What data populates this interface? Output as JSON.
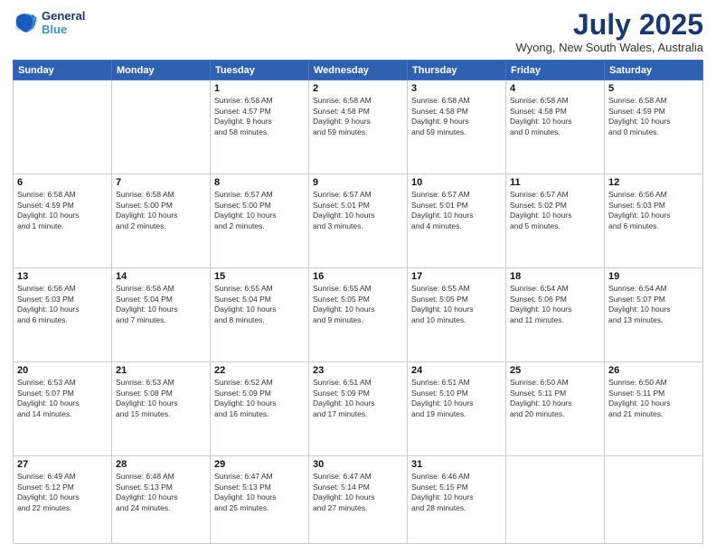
{
  "header": {
    "logo_line1": "General",
    "logo_line2": "Blue",
    "month": "July 2025",
    "location": "Wyong, New South Wales, Australia"
  },
  "days_of_week": [
    "Sunday",
    "Monday",
    "Tuesday",
    "Wednesday",
    "Thursday",
    "Friday",
    "Saturday"
  ],
  "weeks": [
    [
      {
        "day": "",
        "info": ""
      },
      {
        "day": "",
        "info": ""
      },
      {
        "day": "1",
        "info": "Sunrise: 6:58 AM\nSunset: 4:57 PM\nDaylight: 9 hours\nand 58 minutes."
      },
      {
        "day": "2",
        "info": "Sunrise: 6:58 AM\nSunset: 4:58 PM\nDaylight: 9 hours\nand 59 minutes."
      },
      {
        "day": "3",
        "info": "Sunrise: 6:58 AM\nSunset: 4:58 PM\nDaylight: 9 hours\nand 59 minutes."
      },
      {
        "day": "4",
        "info": "Sunrise: 6:58 AM\nSunset: 4:58 PM\nDaylight: 10 hours\nand 0 minutes."
      },
      {
        "day": "5",
        "info": "Sunrise: 6:58 AM\nSunset: 4:59 PM\nDaylight: 10 hours\nand 0 minutes."
      }
    ],
    [
      {
        "day": "6",
        "info": "Sunrise: 6:58 AM\nSunset: 4:59 PM\nDaylight: 10 hours\nand 1 minute."
      },
      {
        "day": "7",
        "info": "Sunrise: 6:58 AM\nSunset: 5:00 PM\nDaylight: 10 hours\nand 2 minutes."
      },
      {
        "day": "8",
        "info": "Sunrise: 6:57 AM\nSunset: 5:00 PM\nDaylight: 10 hours\nand 2 minutes."
      },
      {
        "day": "9",
        "info": "Sunrise: 6:57 AM\nSunset: 5:01 PM\nDaylight: 10 hours\nand 3 minutes."
      },
      {
        "day": "10",
        "info": "Sunrise: 6:57 AM\nSunset: 5:01 PM\nDaylight: 10 hours\nand 4 minutes."
      },
      {
        "day": "11",
        "info": "Sunrise: 6:57 AM\nSunset: 5:02 PM\nDaylight: 10 hours\nand 5 minutes."
      },
      {
        "day": "12",
        "info": "Sunrise: 6:56 AM\nSunset: 5:03 PM\nDaylight: 10 hours\nand 6 minutes."
      }
    ],
    [
      {
        "day": "13",
        "info": "Sunrise: 6:56 AM\nSunset: 5:03 PM\nDaylight: 10 hours\nand 6 minutes."
      },
      {
        "day": "14",
        "info": "Sunrise: 6:56 AM\nSunset: 5:04 PM\nDaylight: 10 hours\nand 7 minutes."
      },
      {
        "day": "15",
        "info": "Sunrise: 6:55 AM\nSunset: 5:04 PM\nDaylight: 10 hours\nand 8 minutes."
      },
      {
        "day": "16",
        "info": "Sunrise: 6:55 AM\nSunset: 5:05 PM\nDaylight: 10 hours\nand 9 minutes."
      },
      {
        "day": "17",
        "info": "Sunrise: 6:55 AM\nSunset: 5:05 PM\nDaylight: 10 hours\nand 10 minutes."
      },
      {
        "day": "18",
        "info": "Sunrise: 6:54 AM\nSunset: 5:06 PM\nDaylight: 10 hours\nand 11 minutes."
      },
      {
        "day": "19",
        "info": "Sunrise: 6:54 AM\nSunset: 5:07 PM\nDaylight: 10 hours\nand 13 minutes."
      }
    ],
    [
      {
        "day": "20",
        "info": "Sunrise: 6:53 AM\nSunset: 5:07 PM\nDaylight: 10 hours\nand 14 minutes."
      },
      {
        "day": "21",
        "info": "Sunrise: 6:53 AM\nSunset: 5:08 PM\nDaylight: 10 hours\nand 15 minutes."
      },
      {
        "day": "22",
        "info": "Sunrise: 6:52 AM\nSunset: 5:09 PM\nDaylight: 10 hours\nand 16 minutes."
      },
      {
        "day": "23",
        "info": "Sunrise: 6:51 AM\nSunset: 5:09 PM\nDaylight: 10 hours\nand 17 minutes."
      },
      {
        "day": "24",
        "info": "Sunrise: 6:51 AM\nSunset: 5:10 PM\nDaylight: 10 hours\nand 19 minutes."
      },
      {
        "day": "25",
        "info": "Sunrise: 6:50 AM\nSunset: 5:11 PM\nDaylight: 10 hours\nand 20 minutes."
      },
      {
        "day": "26",
        "info": "Sunrise: 6:50 AM\nSunset: 5:11 PM\nDaylight: 10 hours\nand 21 minutes."
      }
    ],
    [
      {
        "day": "27",
        "info": "Sunrise: 6:49 AM\nSunset: 5:12 PM\nDaylight: 10 hours\nand 22 minutes."
      },
      {
        "day": "28",
        "info": "Sunrise: 6:48 AM\nSunset: 5:13 PM\nDaylight: 10 hours\nand 24 minutes."
      },
      {
        "day": "29",
        "info": "Sunrise: 6:47 AM\nSunset: 5:13 PM\nDaylight: 10 hours\nand 25 minutes."
      },
      {
        "day": "30",
        "info": "Sunrise: 6:47 AM\nSunset: 5:14 PM\nDaylight: 10 hours\nand 27 minutes."
      },
      {
        "day": "31",
        "info": "Sunrise: 6:46 AM\nSunset: 5:15 PM\nDaylight: 10 hours\nand 28 minutes."
      },
      {
        "day": "",
        "info": ""
      },
      {
        "day": "",
        "info": ""
      }
    ]
  ]
}
